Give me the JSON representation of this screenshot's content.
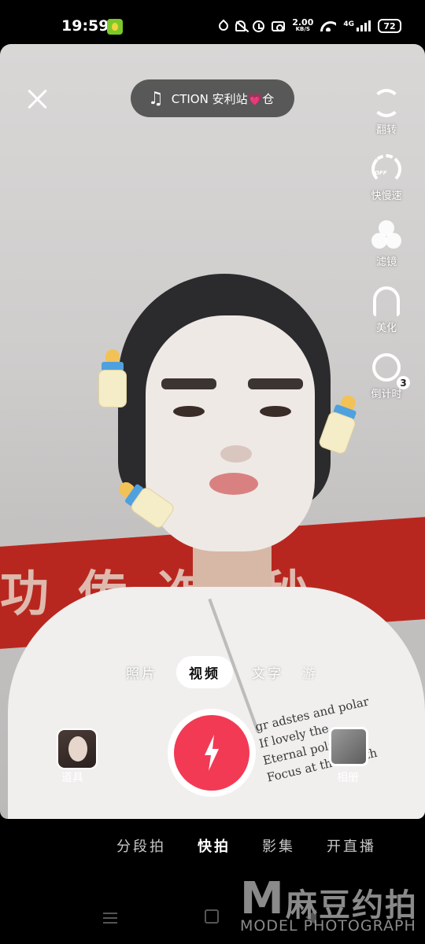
{
  "status_bar": {
    "time": "19:59",
    "net_speed_value": "2.00",
    "net_speed_unit": "KB/S",
    "network": "4G",
    "battery": "72"
  },
  "top": {
    "music_text": "CTION 安利站💗仓"
  },
  "rail": {
    "flip": "翻转",
    "speed": "快慢速",
    "speed_badge": "OFF",
    "filter": "滤镜",
    "beauty": "美化",
    "timer": "倒计时",
    "timer_badge": "3"
  },
  "modes": {
    "photo": "照片",
    "video": "视频",
    "text": "文字",
    "more": "游"
  },
  "capture": {
    "props_label": "道具",
    "album_label": "相册"
  },
  "bottom_modes": {
    "segment": "分段拍",
    "quick": "快拍",
    "collection": "影集",
    "live": "开直播"
  },
  "scene": {
    "banner_text": "功 传 迮, 秒",
    "shirt_print": [
      "gr adstes and polar",
      "If lovely the",
      "Eternal polar the",
      "Focus at the North"
    ]
  },
  "watermark": {
    "mark": "M",
    "cn": "麻豆约拍",
    "en": "MODEL PHOTOGRAPH"
  },
  "colors": {
    "shutter": "#f23a55",
    "banner": "#b8271f",
    "pill_bg": "#282828"
  },
  "icons": [
    "close-icon",
    "music-note-icon",
    "flip-camera-icon",
    "speed-icon",
    "filter-icon",
    "beauty-icon",
    "timer-icon",
    "flash-bolt-icon"
  ]
}
